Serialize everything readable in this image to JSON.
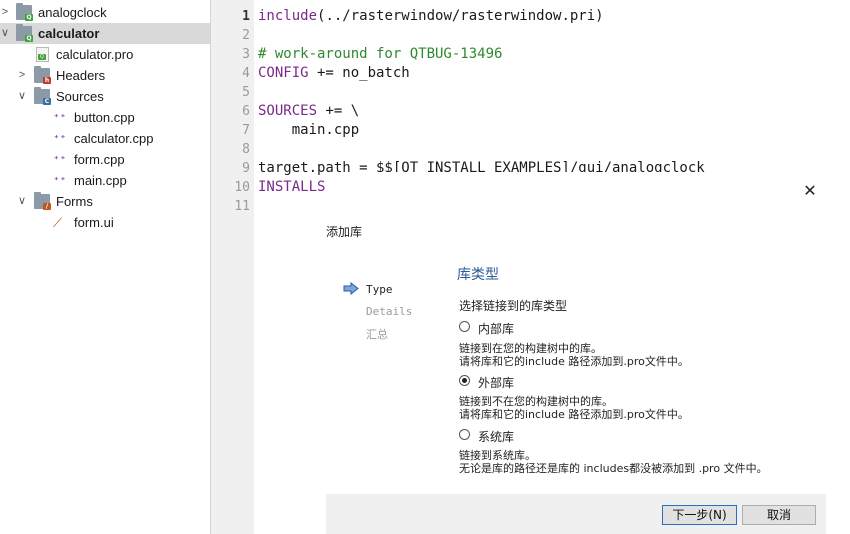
{
  "tree": {
    "items": [
      {
        "label": "analogclock",
        "arrow": ">",
        "icon": "qt-folder-icon"
      },
      {
        "label": "calculator",
        "arrow": "∨",
        "icon": "qt-folder-icon"
      },
      {
        "label": "calculator.pro",
        "icon": "qt-pro-file-icon"
      },
      {
        "label": "Headers",
        "arrow": ">",
        "icon": "headers-folder-icon"
      },
      {
        "label": "Sources",
        "arrow": "∨",
        "icon": "sources-folder-icon"
      },
      {
        "label": "button.cpp",
        "icon": "cpp-file-icon"
      },
      {
        "label": "calculator.cpp",
        "icon": "cpp-file-icon"
      },
      {
        "label": "form.cpp",
        "icon": "cpp-file-icon"
      },
      {
        "label": "main.cpp",
        "icon": "cpp-file-icon"
      },
      {
        "label": "Forms",
        "arrow": "∨",
        "icon": "forms-folder-icon"
      },
      {
        "label": "form.ui",
        "icon": "ui-file-icon"
      }
    ]
  },
  "editor": {
    "line_numbers": [
      "1",
      "2",
      "3",
      "4",
      "5",
      "6",
      "7",
      "8",
      "9",
      "10",
      "11"
    ],
    "lines": [
      [
        {
          "t": "include",
          "c": "kw"
        },
        {
          "t": "(../rasterwindow/rasterwindow.pri)",
          "c": ""
        }
      ],
      [],
      [
        {
          "t": "# work-around for QTBUG-13496",
          "c": "cm"
        }
      ],
      [
        {
          "t": "CONFIG",
          "c": "kw"
        },
        {
          "t": " += no_batch",
          "c": ""
        }
      ],
      [],
      [
        {
          "t": "SOURCES",
          "c": "kw"
        },
        {
          "t": " += \\",
          "c": ""
        }
      ],
      [
        {
          "t": "    main.cpp",
          "c": ""
        }
      ],
      [],
      [
        {
          "t": "target.path = $$[QT_INSTALL_EXAMPLES]/gui/analogclock",
          "c": ""
        }
      ],
      [
        {
          "t": "INSTALLS",
          "c": "kw"
        }
      ],
      []
    ]
  },
  "dialog": {
    "close_symbol": "✕",
    "title": "添加库",
    "steps": [
      "Type",
      "Details",
      "汇总"
    ],
    "page_title": "库类型",
    "page_subtitle": "选择链接到的库类型",
    "options": [
      {
        "label": "内部库",
        "checked": false,
        "desc1": "链接到在您的构建树中的库。",
        "desc2": "请将库和它的include 路径添加到.pro文件中。"
      },
      {
        "label": "外部库",
        "checked": true,
        "desc1": "链接到不在您的构建树中的库。",
        "desc2": "请将库和它的include 路径添加到.pro文件中。"
      },
      {
        "label": "系统库",
        "checked": false,
        "desc1": "链接到系统库。",
        "desc2": "无论是库的路径还是库的 includes都没被添加到 .pro 文件中。"
      }
    ],
    "next_button": "下一步(N)",
    "cancel_button": "取消"
  }
}
